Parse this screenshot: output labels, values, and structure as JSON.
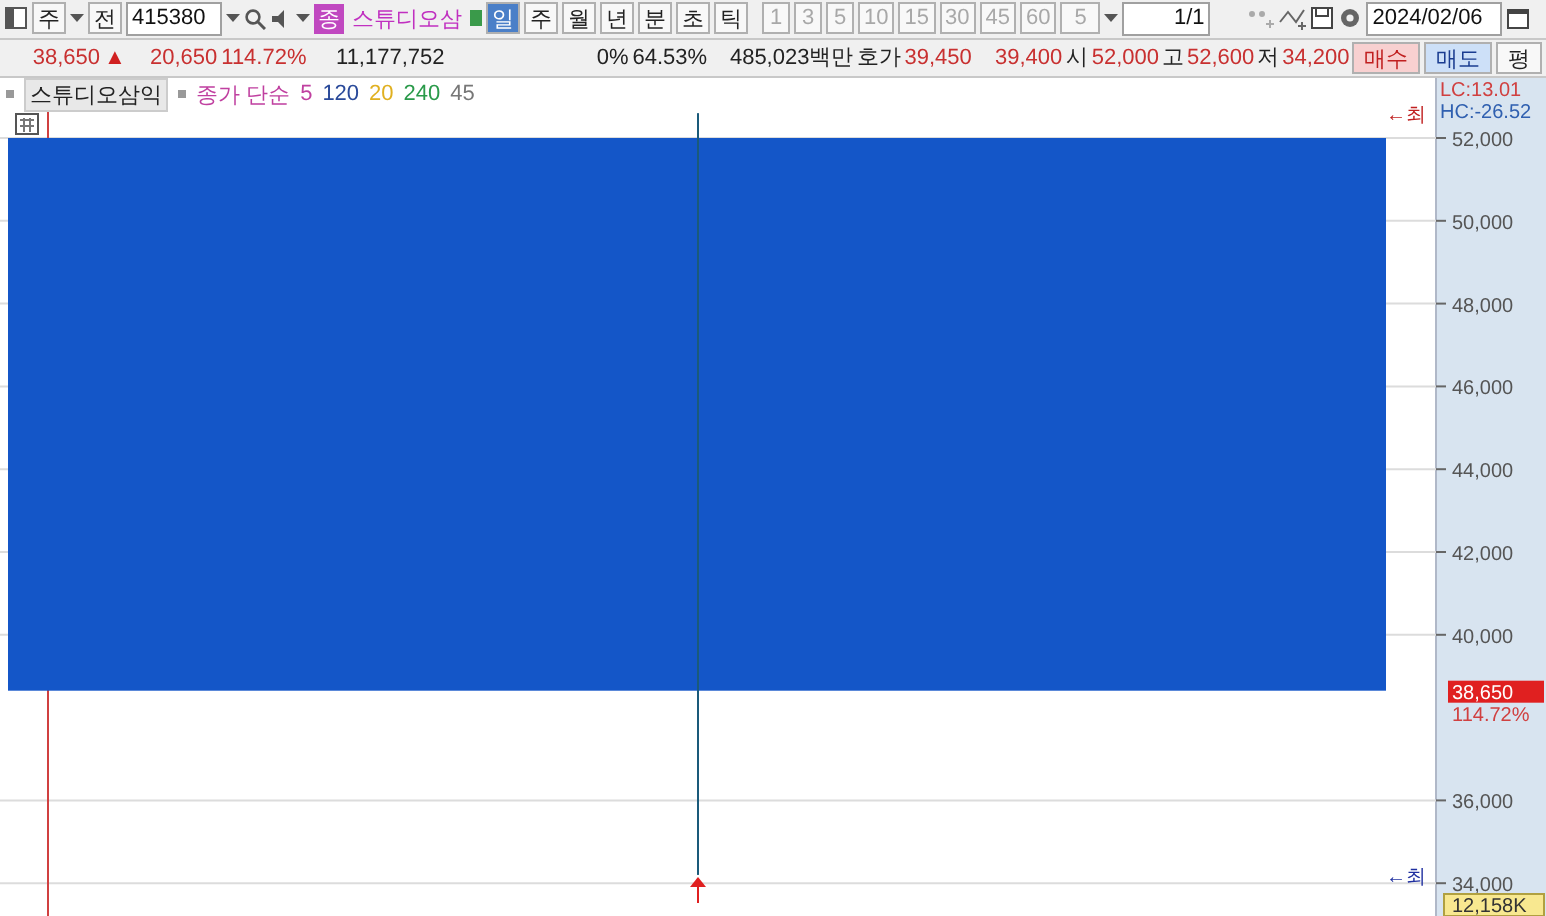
{
  "toolbar": {
    "market": "주",
    "scope": "전",
    "code": "415380",
    "type_badge": "종",
    "stock_name": "스튜디오삼",
    "periods": [
      {
        "label": "일",
        "selected": true
      },
      {
        "label": "주",
        "selected": false
      },
      {
        "label": "월",
        "selected": false
      },
      {
        "label": "년",
        "selected": false
      },
      {
        "label": "분",
        "selected": false
      },
      {
        "label": "초",
        "selected": false
      },
      {
        "label": "틱",
        "selected": false
      }
    ],
    "intervals": [
      {
        "label": "1",
        "disabled": true
      },
      {
        "label": "3",
        "disabled": true
      },
      {
        "label": "5",
        "disabled": true
      },
      {
        "label": "10",
        "disabled": true
      },
      {
        "label": "15",
        "disabled": true
      },
      {
        "label": "30",
        "disabled": true
      },
      {
        "label": "45",
        "disabled": true
      },
      {
        "label": "60",
        "disabled": true
      }
    ],
    "count": "5",
    "page": "1/1",
    "date": "2024/02/06"
  },
  "quote": {
    "price": "38,650",
    "direction": "▲",
    "change": "20,650",
    "change_rate": "114.72%",
    "volume": "11,177,752",
    "field_1": "0%",
    "field_2": "64.53%",
    "amount": "485,023백만",
    "ask_label": "호가",
    "ask": "39,450",
    "bid": "39,400",
    "open_label": "시",
    "open": "52,000",
    "high_label": "고",
    "high": "52,600",
    "low_label": "저",
    "low": "34,200",
    "buttons": [
      {
        "label": "매수",
        "kind": "buy"
      },
      {
        "label": "매도",
        "kind": "sell"
      },
      {
        "label": "평",
        "kind": "plain"
      }
    ]
  },
  "legend": {
    "title": "스튜디오삼익",
    "ma_label": "종가 단순",
    "periods": [
      {
        "label": "5",
        "color": "#c040a0"
      },
      {
        "label": "120",
        "color": "#2a4a9a"
      },
      {
        "label": "20",
        "color": "#e0b020"
      },
      {
        "label": "240",
        "color": "#2a9a4a"
      },
      {
        "label": "45",
        "color": "#777777"
      }
    ]
  },
  "chart": {
    "lc": "LC:13.01",
    "hc": "HC:-26.52",
    "ticks": [
      "52,000",
      "50,000",
      "48,000",
      "46,000",
      "44,000",
      "42,000",
      "40,000",
      "36,000",
      "34,000"
    ],
    "high_marker": "←최",
    "low_marker": "←최",
    "price_tag": "38,650",
    "rate_tag": "114.72%",
    "volume_tag": "12,158K"
  }
}
